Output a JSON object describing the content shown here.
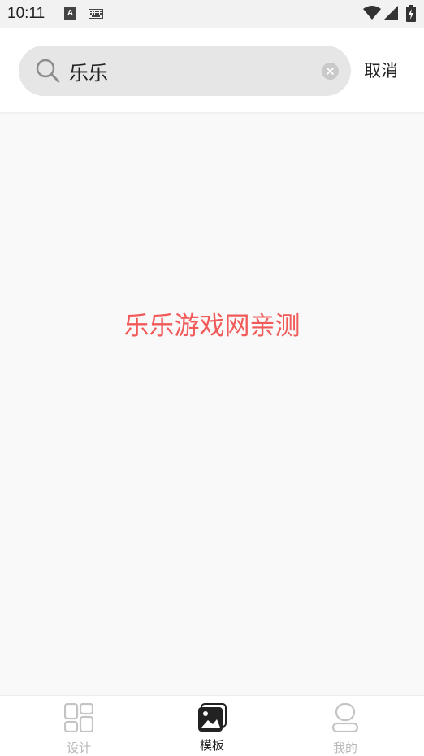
{
  "status_bar": {
    "time": "10:11",
    "a_badge": "A",
    "icons": [
      "a-badge-icon",
      "keyboard-icon",
      "wifi-icon",
      "signal-icon",
      "battery-charging-icon"
    ]
  },
  "search": {
    "value": "乐乐",
    "cancel_label": "取消",
    "icons": [
      "search-icon",
      "clear-icon"
    ]
  },
  "main": {
    "watermark": "乐乐游戏网亲测"
  },
  "bottom_nav": {
    "items": [
      {
        "label": "设计",
        "icon": "grid-icon",
        "active": false
      },
      {
        "label": "模板",
        "icon": "image-icon",
        "active": true
      },
      {
        "label": "我的",
        "icon": "person-icon",
        "active": false
      }
    ]
  },
  "colors": {
    "watermark": "#f25a5a",
    "active_nav": "#222222",
    "inactive_nav": "#b8b8b8",
    "search_box": "#e6e6e6"
  }
}
